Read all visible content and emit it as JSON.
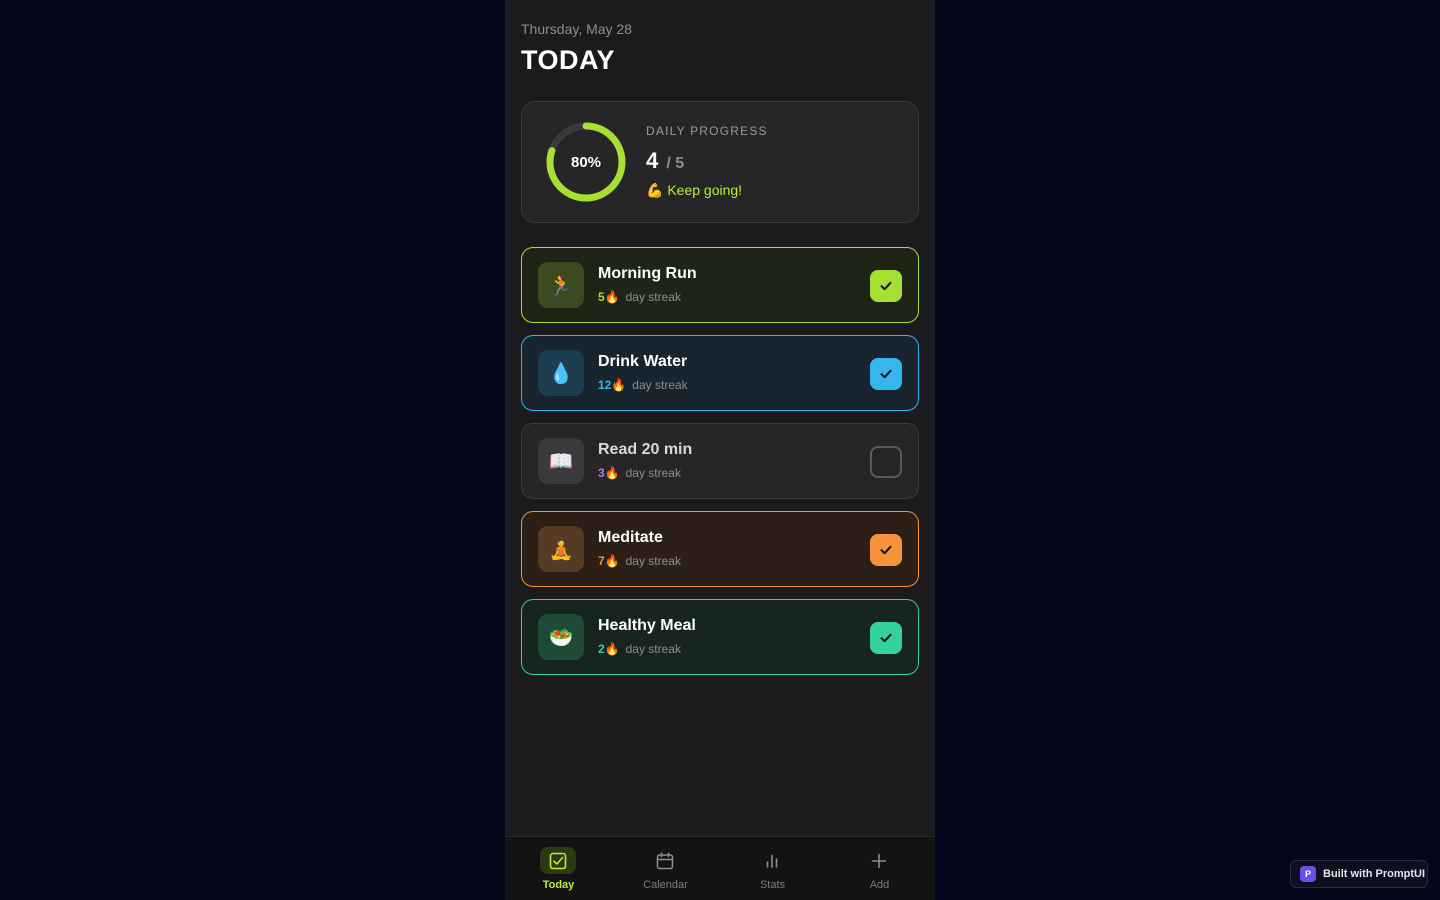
{
  "header": {
    "date": "Thursday, May 28",
    "title": "TODAY"
  },
  "progress": {
    "percent_label": "80%",
    "percent": 80,
    "caption": "DAILY PROGRESS",
    "done": "4",
    "total": "/ 5",
    "message": "💪 Keep going!",
    "accent_color": "#a5e032"
  },
  "habits": [
    {
      "name": "Morning Run",
      "emoji": "🏃",
      "streak": "5🔥",
      "streak_label": "day streak",
      "done": true,
      "color": "#a5e032"
    },
    {
      "name": "Drink Water",
      "emoji": "💧",
      "streak": "12🔥",
      "streak_label": "day streak",
      "done": true,
      "color": "#35b6ee"
    },
    {
      "name": "Read 20 min",
      "emoji": "📖",
      "streak": "3🔥",
      "streak_label": "day streak",
      "done": false,
      "color": "#b07cf5"
    },
    {
      "name": "Meditate",
      "emoji": "🧘",
      "streak": "7🔥",
      "streak_label": "day streak",
      "done": true,
      "color": "#f5923a"
    },
    {
      "name": "Healthy Meal",
      "emoji": "🥗",
      "streak": "2🔥",
      "streak_label": "day streak",
      "done": true,
      "color": "#33d29a"
    }
  ],
  "nav": {
    "items": [
      {
        "label": "Today",
        "icon": "check-square-icon",
        "active": true
      },
      {
        "label": "Calendar",
        "icon": "calendar-icon",
        "active": false
      },
      {
        "label": "Stats",
        "icon": "bar-chart-icon",
        "active": false
      },
      {
        "label": "Add",
        "icon": "plus-icon",
        "active": false
      }
    ]
  },
  "badge": {
    "logo": "P",
    "text": "Built with PromptUI"
  }
}
